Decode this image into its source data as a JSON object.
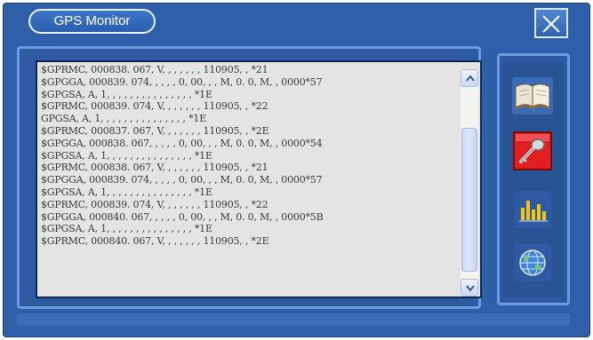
{
  "window": {
    "title": "GPS Monitor",
    "close_icon": "close-x-icon"
  },
  "log": {
    "lines": [
      "$GPRMC, 000838. 067, V, , , , , , , 110905, , *21",
      "$GPGGA, 000839. 074, , , , , 0, 00, , , M, 0. 0, M, , 0000*57",
      "$GPGSA, A, 1, , , , , , , , , , , , , , , *1E",
      "$GPRMC, 000839. 074, V, , , , , , , 110905, , *22",
      "GPGSA, A, 1, , , , , , , , , , , , , , , *1E",
      "$GPRMC, 000837. 067, V, , , , , , , 110905, , *2E",
      "$GPGGA, 000838. 067, , , , , 0, 00, , , M, 0. 0, M, , 0000*54",
      "$GPGSA, A, 1, , , , , , , , , , , , , , , *1E",
      "$GPRMC, 000838. 067, V, , , , , , , 110905, , *21",
      "$GPGGA, 000839. 074, , , , , 0, 00, , , M, 0. 0, M, , 0000*57",
      "$GPGSA, A, 1, , , , , , , , , , , , , , , *1E",
      "$GPRMC, 000839. 074, V, , , , , , , 110905, , *22",
      "$GPGGA, 000840. 067, , , , , 0, 00, , , M, 0. 0, M, , 0000*5B",
      "$GPGSA, A, 1, , , , , , , , , , , , , , , *1E",
      "$GPRMC, 000840. 067, V, , , , , , , 110905, , *2E"
    ]
  },
  "toolbar": {
    "buttons": [
      {
        "icon": "book-icon"
      },
      {
        "icon": "key-icon"
      },
      {
        "icon": "bar-chart-icon"
      },
      {
        "icon": "globe-icon"
      }
    ]
  },
  "colors": {
    "window_bg": "#2f5fa8",
    "log_bg": "#e4e4e4",
    "accent_red": "#e02020"
  }
}
